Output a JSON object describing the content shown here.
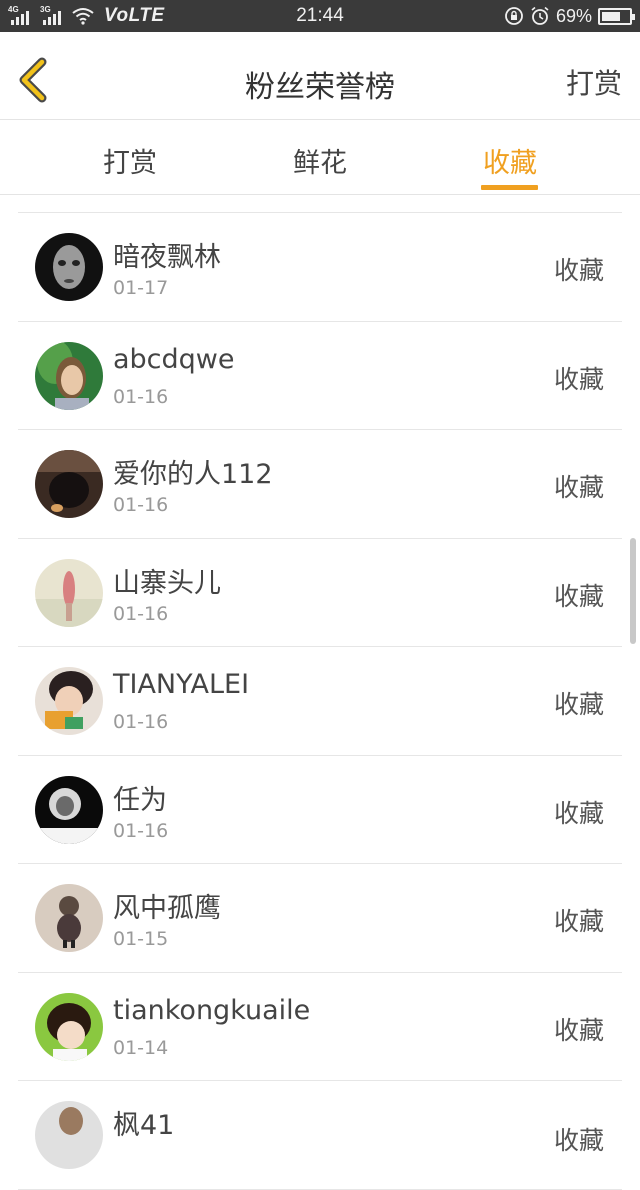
{
  "status_bar": {
    "signal1_label": "4G",
    "signal2_label": "3G",
    "network": "VoLTE",
    "time": "21:44",
    "battery_text": "69%",
    "battery_level": 0.69,
    "icons": [
      "signal-icon",
      "wifi-icon",
      "lock-rotation-icon",
      "alarm-icon",
      "battery-icon"
    ]
  },
  "header": {
    "title": "粉丝荣誉榜",
    "action_label": "打赏",
    "back_icon": "chevron-left-icon",
    "accent_color": "#f0a020"
  },
  "tabs": [
    {
      "label": "打赏",
      "active": false
    },
    {
      "label": "鲜花",
      "active": false
    },
    {
      "label": "收藏",
      "active": true
    }
  ],
  "list": [
    {
      "name": "暗夜飘林",
      "date": "01-17",
      "action": "收藏"
    },
    {
      "name": "abcdqwe",
      "date": "01-16",
      "action": "收藏"
    },
    {
      "name": "爱你的人112",
      "date": "01-16",
      "action": "收藏"
    },
    {
      "name": "山寨头儿",
      "date": "01-16",
      "action": "收藏"
    },
    {
      "name": "TIANYALEI",
      "date": "01-16",
      "action": "收藏"
    },
    {
      "name": "任为",
      "date": "01-16",
      "action": "收藏"
    },
    {
      "name": "风中孤鹰",
      "date": "01-15",
      "action": "收藏"
    },
    {
      "name": "tiankongkuaile",
      "date": "01-14",
      "action": "收藏"
    },
    {
      "name": "枫41",
      "date": "",
      "action": "收藏"
    }
  ]
}
